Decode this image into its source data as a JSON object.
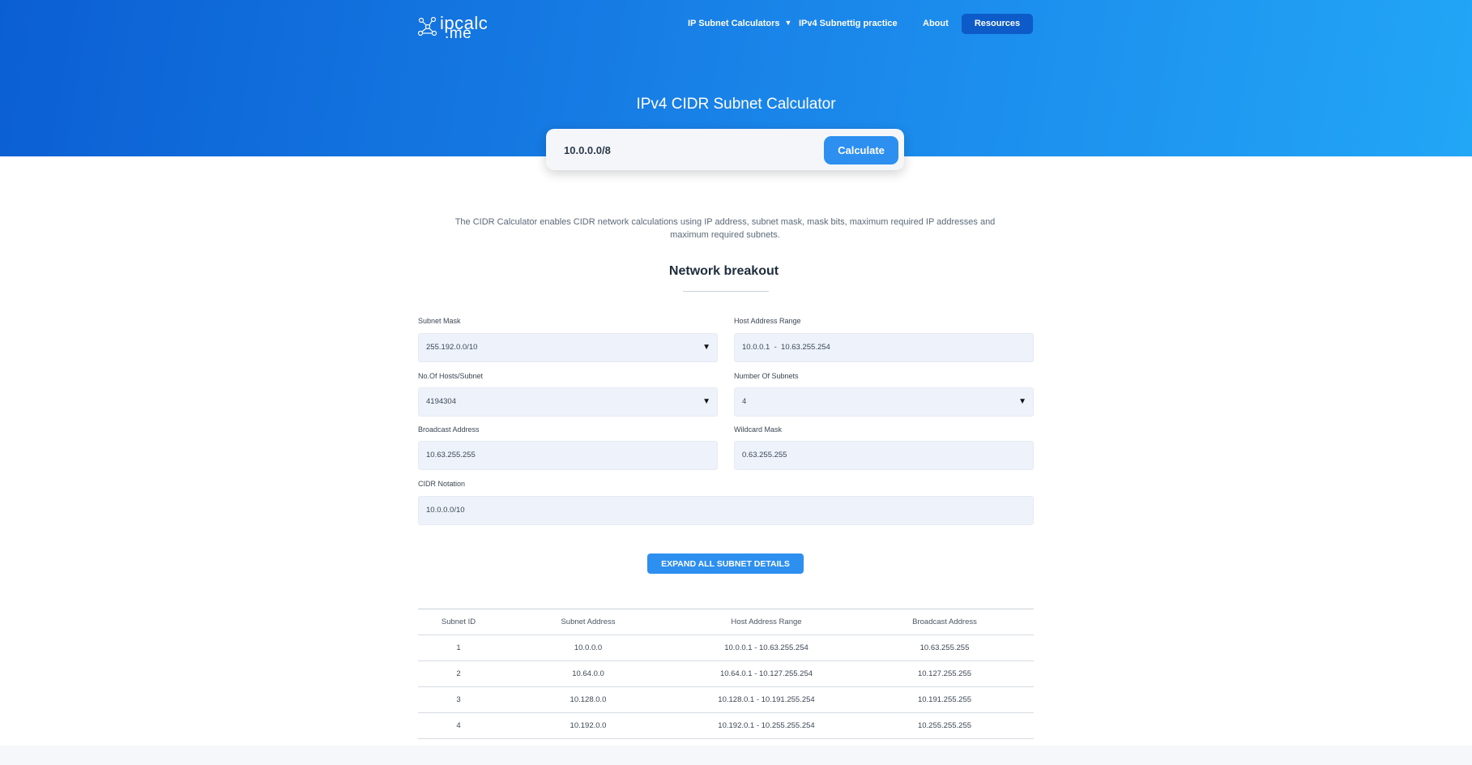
{
  "nav": {
    "logo_line1": "ipcalc",
    "logo_line2": ".me",
    "items": [
      {
        "label": "IP Subnet Calculators",
        "has_dropdown": true
      },
      {
        "label": "IPv4 Subnettig practice"
      },
      {
        "label": "About"
      }
    ],
    "resources_label": "Resources"
  },
  "hero": {
    "title": "IPv4 CIDR Subnet Calculator",
    "input_value": "10.0.0.0/8",
    "calculate_label": "Calculate"
  },
  "intro": "The CIDR Calculator enables CIDR network calculations using IP address, subnet mask, mask bits, maximum required IP addresses and maximum required subnets.",
  "breakout": {
    "title": "Network breakout",
    "subnet_mask": {
      "label": "Subnet Mask",
      "value": "255.192.0.0/10"
    },
    "host_range": {
      "label": "Host Address Range",
      "value": "10.0.0.1  -  10.63.255.254"
    },
    "hosts_per_subnet": {
      "label": "No.Of Hosts/Subnet",
      "value": "4194304"
    },
    "num_subnets": {
      "label": "Number Of Subnets",
      "value": "4"
    },
    "broadcast": {
      "label": "Broadcast Address",
      "value": "10.63.255.255"
    },
    "wildcard": {
      "label": "Wildcard Mask",
      "value": "0.63.255.255"
    },
    "cidr": {
      "label": "CIDR Notation",
      "value": "10.0.0.0/10"
    },
    "expand_label": "EXPAND ALL SUBNET DETAILS"
  },
  "table": {
    "headers": [
      "Subnet ID",
      "Subnet Address",
      "Host Address Range",
      "Broadcast Address"
    ],
    "rows": [
      [
        "1",
        "10.0.0.0",
        "10.0.0.1 - 10.63.255.254",
        "10.63.255.255"
      ],
      [
        "2",
        "10.64.0.0",
        "10.64.0.1 - 10.127.255.254",
        "10.127.255.255"
      ],
      [
        "3",
        "10.128.0.0",
        "10.128.0.1 - 10.191.255.254",
        "10.191.255.255"
      ],
      [
        "4",
        "10.192.0.0",
        "10.192.0.1 - 10.255.255.254",
        "10.255.255.255"
      ]
    ]
  },
  "colors": {
    "hero_gradient_start": "#0b5fd3",
    "hero_gradient_end": "#22a6f6",
    "accent_button": "#2d8ff0",
    "resources_button": "#0c5bc9",
    "field_background": "#eef3fb"
  },
  "icons": [
    "network-logo-icon",
    "caret-down-icon",
    "select-arrow-icon"
  ]
}
